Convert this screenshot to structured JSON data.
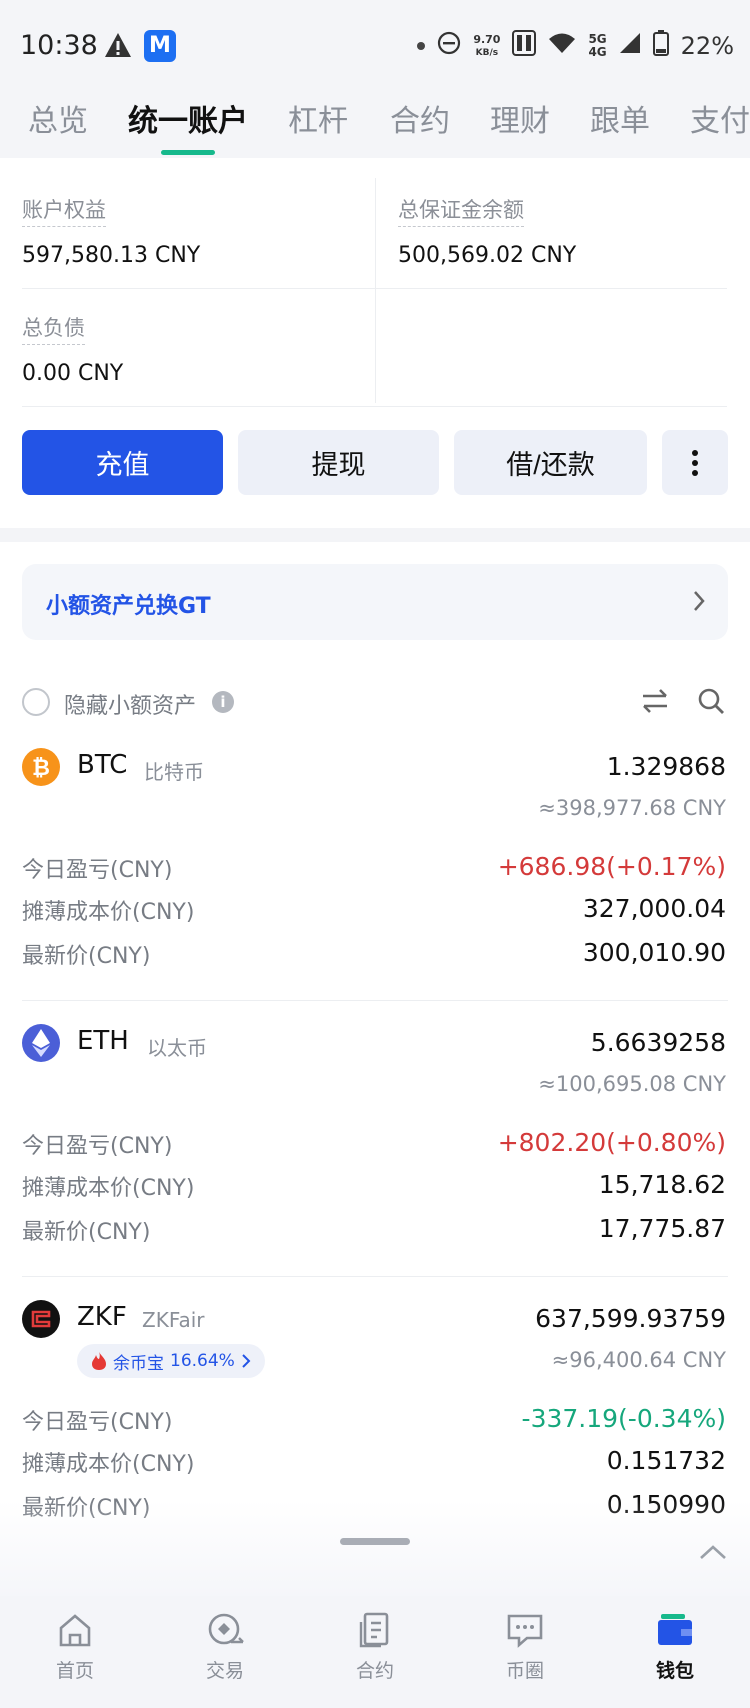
{
  "status_bar": {
    "time": "10:38",
    "speed_value": "9.70",
    "speed_unit": "KB/s",
    "net_top": "5G",
    "net_bottom": "4G",
    "battery": "22%"
  },
  "tabs": [
    {
      "label": "总览"
    },
    {
      "label": "统一账户"
    },
    {
      "label": "杠杆"
    },
    {
      "label": "合约"
    },
    {
      "label": "理财"
    },
    {
      "label": "跟单"
    },
    {
      "label": "支付"
    }
  ],
  "account": {
    "equity_label": "账户权益",
    "equity_value": "597,580.13 CNY",
    "margin_label": "总保证金余额",
    "margin_value": "500,569.02 CNY",
    "liability_label": "总负债",
    "liability_value": "0.00 CNY"
  },
  "actions": {
    "deposit": "充值",
    "withdraw": "提现",
    "borrow": "借/还款"
  },
  "banner": {
    "text": "小额资产兑换GT"
  },
  "filter": {
    "hide_small_label": "隐藏小额资产"
  },
  "assets": [
    {
      "symbol": "BTC",
      "name": "比特币",
      "amount": "1.329868",
      "approx_value": "≈398,977.68 CNY",
      "pnl_label": "今日盈亏(CNY)",
      "pnl": "+686.98(+0.17%)",
      "cost_label": "摊薄成本价(CNY)",
      "cost": "327,000.04",
      "price_label": "最新价(CNY)",
      "price": "300,010.90"
    },
    {
      "symbol": "ETH",
      "name": "以太币",
      "amount": "5.6639258",
      "approx_value": "≈100,695.08 CNY",
      "pnl_label": "今日盈亏(CNY)",
      "pnl": "+802.20(+0.80%)",
      "cost_label": "摊薄成本价(CNY)",
      "cost": "15,718.62",
      "price_label": "最新价(CNY)",
      "price": "17,775.87"
    },
    {
      "symbol": "ZKF",
      "name": "ZKFair",
      "amount": "637,599.93759",
      "approx_value": "≈96,400.64 CNY",
      "badge_label": "余币宝",
      "badge_rate": "16.64%",
      "pnl_label": "今日盈亏(CNY)",
      "pnl": "-337.19(-0.34%)",
      "cost_label": "摊薄成本价(CNY)",
      "cost": "0.151732",
      "price_label": "最新价(CNY)",
      "price": "0.150990"
    }
  ],
  "bottom_nav": [
    {
      "label": "首页",
      "icon": "home-icon"
    },
    {
      "label": "交易",
      "icon": "trade-icon"
    },
    {
      "label": "合约",
      "icon": "contract-icon"
    },
    {
      "label": "币圈",
      "icon": "community-icon"
    },
    {
      "label": "钱包",
      "icon": "wallet-icon"
    }
  ],
  "colors": {
    "accent": "#2354e6",
    "tab_indicator": "#17b98c",
    "positive": "#d43a3a",
    "negative": "#16a77c",
    "btc": "#f7931a",
    "eth": "#4b5fd7"
  }
}
